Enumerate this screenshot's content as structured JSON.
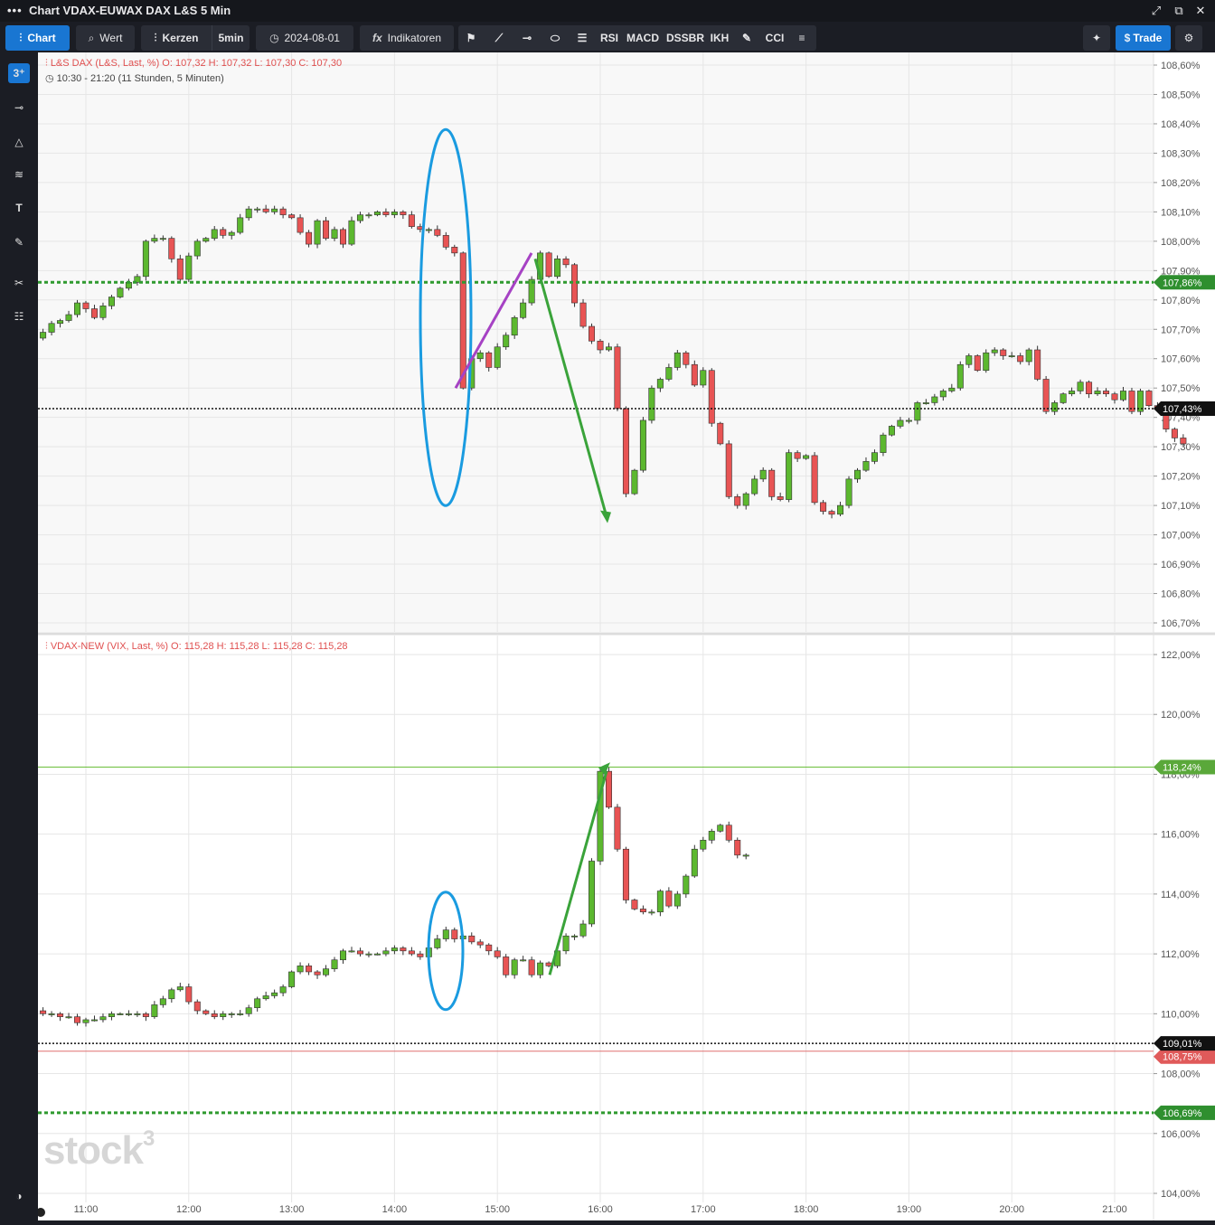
{
  "window": {
    "title": "Chart VDAX-EUWAX DAX L&S 5 Min"
  },
  "toolbar": {
    "chart_label": "Chart",
    "wert_label": "Wert",
    "kerzen_label": "Kerzen",
    "interval_label": "5min",
    "date_label": "2024-08-01",
    "indicators_label": "Indikatoren",
    "ind_rsi": "RSI",
    "ind_macd": "MACD",
    "ind_dssbr": "DSSBR",
    "ind_ikh": "IKH",
    "ind_cci": "CCI",
    "trade_label": "Trade"
  },
  "colors": {
    "accent": "#1976d2",
    "up": "#5cb82f",
    "down": "#e85454",
    "ellipse": "#1a9be0",
    "arrow_green": "#3aa33a",
    "arrow_purple": "#a642c4"
  },
  "pane1": {
    "legend": "L&S DAX (L&S, Last, %)  O: 107,32  H: 107,32  L: 107,30  C: 107,30",
    "session": "10:30 - 21:20   (11 Stunden, 5 Minuten)",
    "price_labels": [
      "108,60%",
      "108,50%",
      "108,40%",
      "108,30%",
      "108,20%",
      "108,10%",
      "108,00%",
      "107,90%",
      "107,80%",
      "107,70%",
      "107,60%",
      "107,50%",
      "107,40%",
      "107,30%",
      "107,20%",
      "107,10%",
      "107,00%",
      "106,90%",
      "106,80%",
      "106,70%"
    ],
    "marker_green": "107,86%",
    "marker_last": "107,43%"
  },
  "pane2": {
    "legend": "VDAX-NEW (VIX, Last, %)  O: 115,28  H: 115,28  L: 115,28  C: 115,28",
    "price_labels": [
      "122,00%",
      "120,00%",
      "118,00%",
      "116,00%",
      "114,00%",
      "112,00%",
      "110,00%",
      "108,00%",
      "106,00%",
      "104,00%"
    ],
    "marker_line": "118,24%",
    "marker_last": "109,01%",
    "marker_green": "106,69%"
  },
  "time_labels": [
    "11:00",
    "12:00",
    "13:00",
    "14:00",
    "15:00",
    "16:00",
    "17:00",
    "18:00",
    "19:00",
    "20:00",
    "21:00"
  ],
  "watermark": "stock",
  "chart_data": [
    {
      "type": "candlestick",
      "title": "L&S DAX (L&S, Last, %)",
      "ylim": [
        106.68,
        108.62
      ],
      "y_tick_step": 0.1,
      "x_ticks": [
        "11:00",
        "12:00",
        "13:00",
        "14:00",
        "15:00",
        "16:00",
        "17:00",
        "18:00",
        "19:00",
        "20:00",
        "21:00"
      ],
      "closes": [
        107.67,
        107.69,
        107.72,
        107.73,
        107.75,
        107.79,
        107.77,
        107.74,
        107.78,
        107.81,
        107.84,
        107.86,
        107.88,
        108.0,
        108.01,
        108.01,
        107.94,
        107.87,
        107.95,
        108.0,
        108.01,
        108.04,
        108.02,
        108.03,
        108.08,
        108.11,
        108.11,
        108.1,
        108.11,
        108.09,
        108.08,
        108.03,
        107.99,
        108.07,
        108.01,
        108.04,
        107.99,
        108.07,
        108.09,
        108.09,
        108.1,
        108.09,
        108.1,
        108.09,
        108.05,
        108.04,
        108.04,
        108.02,
        107.98,
        107.96,
        107.5,
        107.6,
        107.62,
        107.57,
        107.64,
        107.68,
        107.74,
        107.79,
        107.87,
        107.96,
        107.88,
        107.94,
        107.92,
        107.79,
        107.71,
        107.66,
        107.63,
        107.64,
        107.43,
        107.14,
        107.22,
        107.39,
        107.5,
        107.53,
        107.57,
        107.62,
        107.58,
        107.51,
        107.56,
        107.38,
        107.31,
        107.13,
        107.1,
        107.14,
        107.19,
        107.22,
        107.13,
        107.12,
        107.28,
        107.26,
        107.27,
        107.11,
        107.08,
        107.07,
        107.1,
        107.19,
        107.22,
        107.25,
        107.28,
        107.34,
        107.37,
        107.39,
        107.39,
        107.45,
        107.45,
        107.47,
        107.49,
        107.5,
        107.58,
        107.61,
        107.56,
        107.62,
        107.63,
        107.61,
        107.61,
        107.59,
        107.63,
        107.53,
        107.42,
        107.45,
        107.48,
        107.49,
        107.52,
        107.48,
        107.49,
        107.48,
        107.46,
        107.49,
        107.42,
        107.49,
        107.44,
        107.43,
        107.36,
        107.33,
        107.31
      ],
      "annotations": [
        "ellipse around 14:30 drop",
        "purple arrow 14:35-15:20",
        "green arrow 15:20-16:05",
        "dotted line 107,86%",
        "dotted last 107,43%"
      ]
    },
    {
      "type": "candlestick",
      "title": "VDAX-NEW (VIX, Last, %)",
      "ylim": [
        103.9,
        122.4
      ],
      "y_tick_step": 2,
      "closes": [
        110.1,
        110.0,
        110.0,
        109.9,
        109.9,
        109.7,
        109.8,
        109.8,
        109.9,
        110.0,
        110.0,
        110.0,
        110.0,
        109.9,
        110.3,
        110.5,
        110.8,
        110.9,
        110.4,
        110.1,
        110.0,
        109.9,
        110.0,
        110.0,
        110.0,
        110.2,
        110.5,
        110.6,
        110.7,
        110.9,
        111.4,
        111.6,
        111.4,
        111.3,
        111.5,
        111.8,
        112.1,
        112.1,
        112.0,
        112.0,
        112.0,
        112.1,
        112.2,
        112.1,
        112.0,
        111.9,
        112.2,
        112.5,
        112.8,
        112.5,
        112.6,
        112.4,
        112.3,
        112.1,
        111.9,
        111.3,
        111.8,
        111.8,
        111.3,
        111.7,
        111.6,
        112.1,
        112.6,
        112.6,
        113.0,
        115.1,
        118.1,
        116.9,
        115.5,
        113.8,
        113.5,
        113.4,
        113.4,
        114.1,
        113.6,
        114.0,
        114.6,
        115.5,
        115.8,
        116.1,
        116.3,
        115.8,
        115.3,
        115.3
      ]
    }
  ]
}
